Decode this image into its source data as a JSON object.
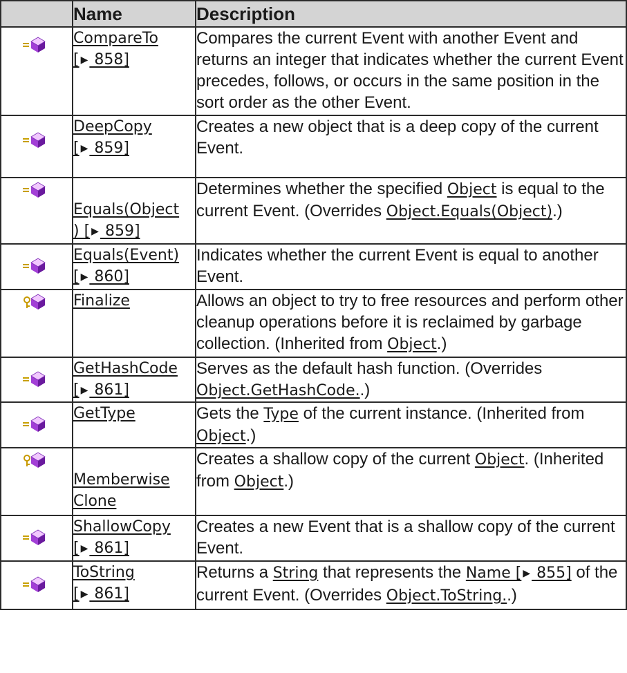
{
  "header": {
    "name": "Name",
    "description": "Description"
  },
  "icons": {
    "public_method": "public-method-icon",
    "protected_method": "protected-method-icon"
  },
  "rows": [
    {
      "icon": "public-method-icon",
      "name_a": "CompareTo",
      "name_b": "[",
      "name_page": " 858]",
      "desc_a": "Compares the current Event with another Event and returns an integer that indicates whether the current Event precedes, follows, or occurs in the same position in the sort order as the other Event."
    },
    {
      "icon": "public-method-icon",
      "name_a": "DeepCopy",
      "name_b": "[",
      "name_page": " 859]",
      "desc_a": "Creates a new object that is a deep copy of the current Event."
    },
    {
      "icon": "public-method-icon",
      "name_a": "Equals(Object",
      "name_b": ") [",
      "name_page": " 859]",
      "desc_a": "Determines whether the specified ",
      "desc_link1": "Object",
      "desc_b": " is equal to the current Event. (Overrides ",
      "desc_link2": "Object.Equals(Object)",
      "desc_c": ".)"
    },
    {
      "icon": "public-method-icon",
      "name_a": "Equals(Event)",
      "name_b": "[",
      "name_page": " 860]",
      "desc_a": "Indicates whether the current Event is equal to another Event."
    },
    {
      "icon": "protected-method-icon",
      "name_a": "Finalize",
      "desc_a": "Allows an object to try to free resources and perform other cleanup operations before it is reclaimed by garbage collection. (Inherited from ",
      "desc_link1": "Object",
      "desc_b": ".)"
    },
    {
      "icon": "public-method-icon",
      "name_a": "GetHashCode",
      "name_b": "[",
      "name_page": " 861]",
      "desc_a": "Serves as the default hash function. (Overrides ",
      "desc_link1": "Object.GetHashCode.",
      "desc_b": ".)"
    },
    {
      "icon": "public-method-icon",
      "name_a": "GetType",
      "desc_a": "Gets the ",
      "desc_link1": "Type",
      "desc_b": " of the current instance. (Inherited from ",
      "desc_link2": "Object",
      "desc_c": ".)"
    },
    {
      "icon": "protected-method-icon",
      "name_a": "Memberwise",
      "name_c": "Clone",
      "desc_a": "Creates a shallow copy of the current ",
      "desc_link1": "Object",
      "desc_b": ". (Inherited from ",
      "desc_link2": "Object",
      "desc_c": ".)"
    },
    {
      "icon": "public-method-icon",
      "name_a": "ShallowCopy",
      "name_b": "[",
      "name_page": " 861]",
      "desc_a": "Creates a new Event that is a shallow copy of the current Event."
    },
    {
      "icon": "public-method-icon",
      "name_a": "ToString",
      "name_b": "[",
      "name_page": " 861]",
      "desc_a": "Returns a ",
      "desc_link1": "String",
      "desc_b": " that represents the ",
      "desc_link2": "Name [",
      "desc_link2_page": " 855]",
      "desc_c": " of the current Event. (Overrides ",
      "desc_link3": "Object.ToString.",
      "desc_d": ".)"
    }
  ]
}
